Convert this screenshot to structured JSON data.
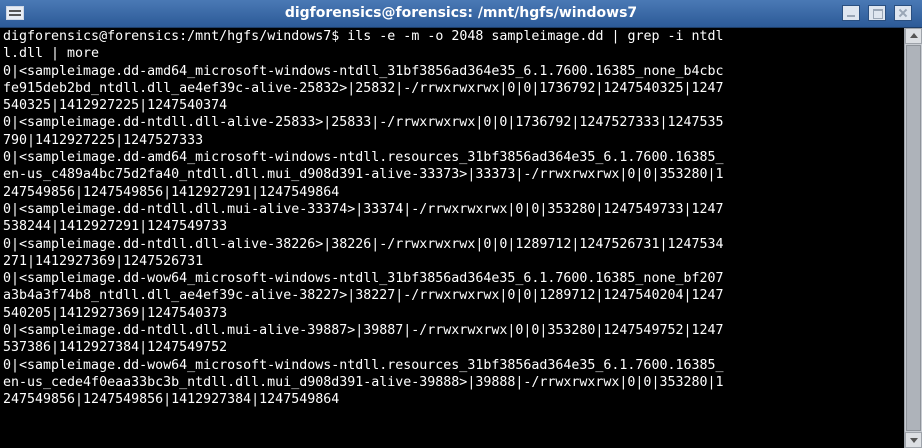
{
  "window": {
    "title": "digforensics@forensics: /mnt/hgfs/windows7"
  },
  "prompt": {
    "user_host": "digforensics@forensics",
    "separator": ":",
    "path": "/mnt/hgfs/windows7",
    "symbol": "$",
    "command": " ils -e -m -o 2048 sampleimage.dd | grep -i ntdl"
  },
  "lines": [
    "l.dll | more",
    "0|<sampleimage.dd-amd64_microsoft-windows-ntdll_31bf3856ad364e35_6.1.7600.16385_none_b4cbc",
    "fe915deb2bd_ntdll.dll_ae4ef39c-alive-25832>|25832|-/rrwxrwxrwx|0|0|1736792|1247540325|1247",
    "540325|1412927225|1247540374",
    "0|<sampleimage.dd-ntdll.dll-alive-25833>|25833|-/rrwxrwxrwx|0|0|1736792|1247527333|1247535",
    "790|1412927225|1247527333",
    "0|<sampleimage.dd-amd64_microsoft-windows-ntdll.resources_31bf3856ad364e35_6.1.7600.16385_",
    "en-us_c489a4bc75d2fa40_ntdll.dll.mui_d908d391-alive-33373>|33373|-/rrwxrwxrwx|0|0|353280|1",
    "247549856|1247549856|1412927291|1247549864",
    "0|<sampleimage.dd-ntdll.dll.mui-alive-33374>|33374|-/rrwxrwxrwx|0|0|353280|1247549733|1247",
    "538244|1412927291|1247549733",
    "0|<sampleimage.dd-ntdll.dll-alive-38226>|38226|-/rrwxrwxrwx|0|0|1289712|1247526731|1247534",
    "271|1412927369|1247526731",
    "0|<sampleimage.dd-wow64_microsoft-windows-ntdll_31bf3856ad364e35_6.1.7600.16385_none_bf207",
    "a3b4a3f74b8_ntdll.dll_ae4ef39c-alive-38227>|38227|-/rrwxrwxrwx|0|0|1289712|1247540204|1247",
    "540205|1412927369|1247540373",
    "0|<sampleimage.dd-ntdll.dll.mui-alive-39887>|39887|-/rrwxrwxrwx|0|0|353280|1247549752|1247",
    "537386|1412927384|1247549752",
    "0|<sampleimage.dd-wow64_microsoft-windows-ntdll.resources_31bf3856ad364e35_6.1.7600.16385_",
    "en-us_cede4f0eaa33bc3b_ntdll.dll.mui_d908d391-alive-39888>|39888|-/rrwxrwxrwx|0|0|353280|1",
    "247549856|1247549856|1412927384|1247549864"
  ],
  "colors": {
    "titlebar": "#2c5a97",
    "terminal_bg": "#000000",
    "terminal_fg": "#ffffff"
  },
  "icons": {
    "window_menu": "window-menu-icon",
    "minimize": "minimize-icon",
    "maximize": "maximize-icon",
    "close": "close-icon"
  }
}
